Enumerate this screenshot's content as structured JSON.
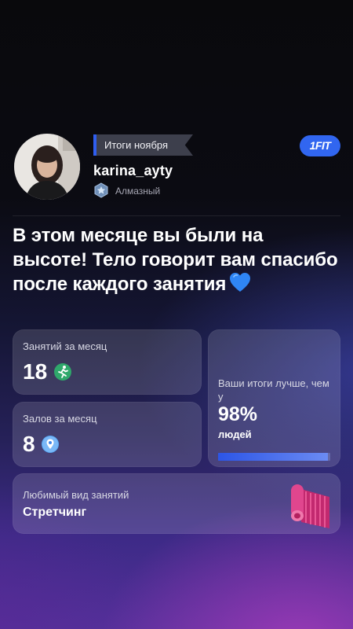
{
  "header": {
    "month_label": "Итоги ноября",
    "username": "karina_ayty",
    "level": "Алмазный",
    "brand": "1FIT"
  },
  "headline": "В этом месяце вы были на высоте! Тело говорит вам спасибо после каждого занятия",
  "stats": {
    "workouts": {
      "label": "Занятий за месяц",
      "value": "18",
      "icon": "running-person-icon"
    },
    "gyms": {
      "label": "Залов за месяц",
      "value": "8",
      "icon": "location-pin-icon"
    },
    "comparison": {
      "label": "Ваши итоги лучше, чем у",
      "percent": "98%",
      "suffix": "людей",
      "progress": 0.98
    },
    "favorite": {
      "label": "Любимый вид занятий",
      "value": "Стретчинг",
      "icon": "yoga-mat-icon"
    }
  },
  "colors": {
    "accent_blue": "#2F5EF0",
    "brand_blue": "#3166F0",
    "mat_pink": "#E0468E",
    "running_green": "#2FA86B"
  }
}
